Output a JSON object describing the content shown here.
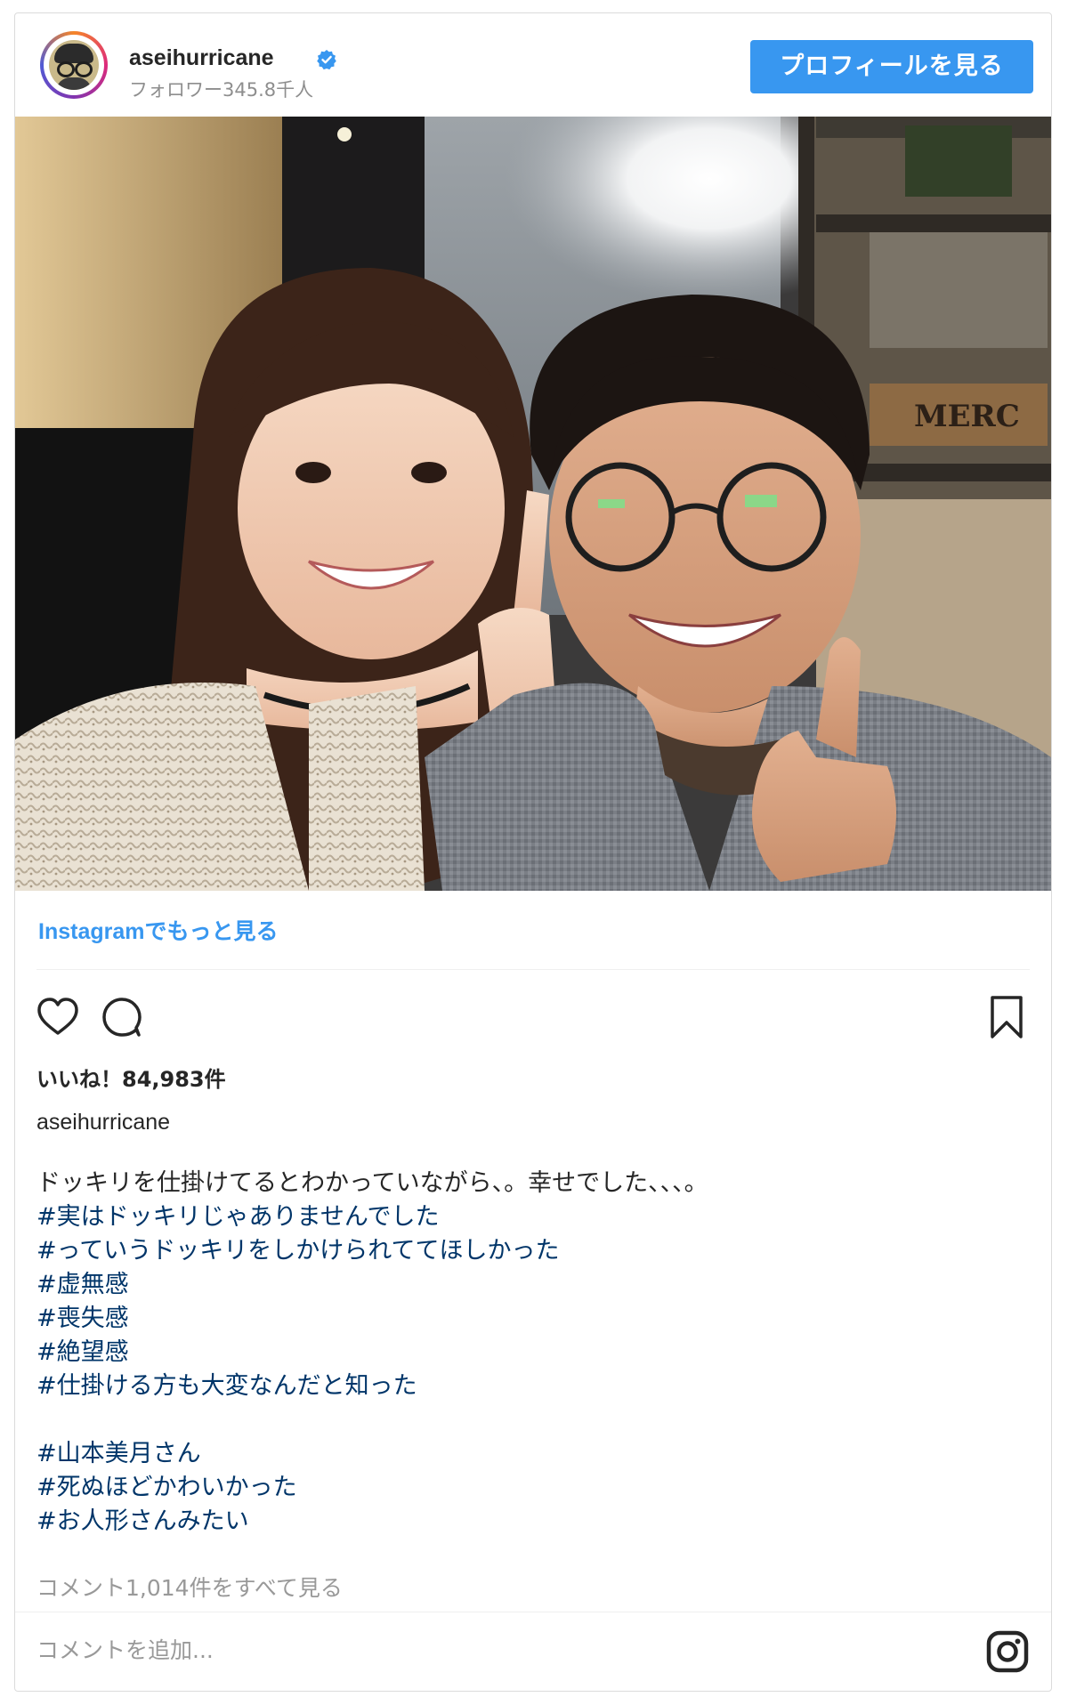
{
  "header": {
    "username": "aseihurricane",
    "followers": "フォロワー345.8千人",
    "profile_button": "プロフィールを見る"
  },
  "photo": {
    "sign_text": "MERC"
  },
  "more_link": "Instagramでもっと見る",
  "actions": {
    "like_icon": "heart-icon",
    "comment_icon": "comment-icon",
    "save_icon": "bookmark-icon"
  },
  "likes": "いいね！84,983件",
  "caption": {
    "username": "aseihurricane",
    "lines": [
      {
        "text": "ドッキリを仕掛けてるとわかっていながら、。幸せでした、、、。",
        "type": "text"
      },
      {
        "text": "#実はドッキリじゃありませんでした",
        "type": "tag"
      },
      {
        "text": "#っていうドッキリをしかけられててほしかった",
        "type": "tag"
      },
      {
        "text": "#虚無感",
        "type": "tag"
      },
      {
        "text": "#喪失感",
        "type": "tag"
      },
      {
        "text": "#絶望感",
        "type": "tag"
      },
      {
        "text": "#仕掛ける方も大変なんだと知った",
        "type": "tag"
      },
      {
        "text": "",
        "type": "blank"
      },
      {
        "text": "#山本美月さん",
        "type": "tag"
      },
      {
        "text": "#死ぬほどかわいかった",
        "type": "tag"
      },
      {
        "text": "#お人形さんみたい",
        "type": "tag"
      }
    ]
  },
  "view_comments": "コメント1,014件をすべて見る",
  "add_comment_placeholder": "コメントを追加...",
  "colors": {
    "accent": "#3897f0",
    "hashtag": "#003569",
    "muted": "#999999"
  }
}
